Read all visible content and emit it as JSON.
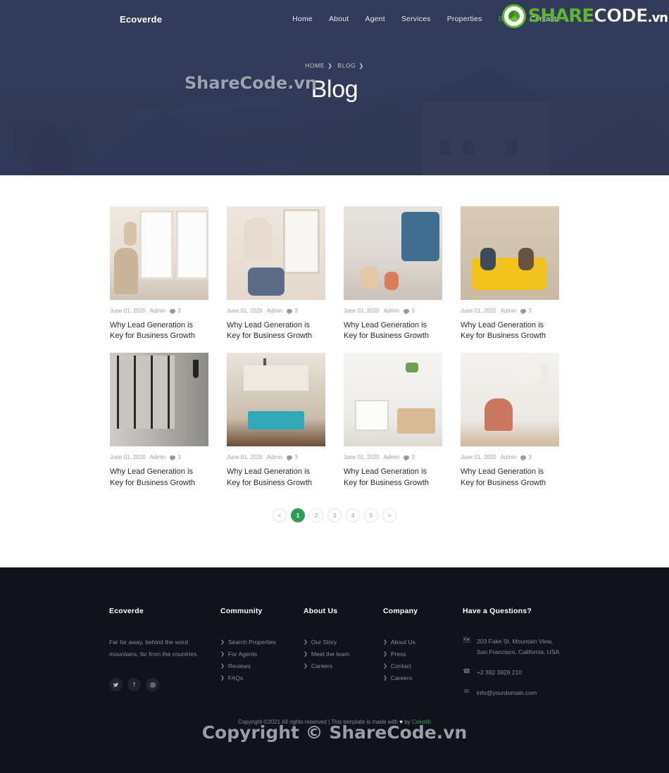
{
  "site": {
    "brand": "Ecoverde"
  },
  "nav": {
    "items": [
      {
        "label": "Home",
        "active": false
      },
      {
        "label": "About",
        "active": false
      },
      {
        "label": "Agent",
        "active": false
      },
      {
        "label": "Services",
        "active": false
      },
      {
        "label": "Properties",
        "active": false
      },
      {
        "label": "Blog",
        "active": true
      },
      {
        "label": "Contact",
        "active": false
      }
    ]
  },
  "watermark": {
    "hero": "ShareCode.vn",
    "footer": "Copyright © ShareCode.vn",
    "logo_share": "SHARE",
    "logo_code": "CODE",
    "logo_vn": ".vn"
  },
  "hero": {
    "breadcrumb": [
      {
        "label": "HOME"
      },
      {
        "label": "BLOG"
      }
    ],
    "separator": "❯",
    "title": "Blog"
  },
  "blog": {
    "posts": [
      {
        "date": "June 01, 2020",
        "author": "Admin",
        "comments": "3",
        "title": "Why Lead Generation is Key for Business Growth",
        "image": "mother-and-baby-by-window"
      },
      {
        "date": "June 01, 2020",
        "author": "Admin",
        "comments": "3",
        "title": "Why Lead Generation is Key for Business Growth",
        "image": "mother-holding-toddler"
      },
      {
        "date": "June 01, 2020",
        "author": "Admin",
        "comments": "3",
        "title": "Why Lead Generation is Key for Business Growth",
        "image": "family-playing-in-living-room"
      },
      {
        "date": "June 01, 2020",
        "author": "Admin",
        "comments": "3",
        "title": "Why Lead Generation is Key for Business Growth",
        "image": "family-on-yellow-sofa-with-boxes"
      },
      {
        "date": "June 01, 2020",
        "author": "Admin",
        "comments": "3",
        "title": "Why Lead Generation is Key for Business Growth",
        "image": "modern-glass-hallway"
      },
      {
        "date": "June 01, 2020",
        "author": "Admin",
        "comments": "3",
        "title": "Why Lead Generation is Key for Business Growth",
        "image": "kitchen-with-blue-island"
      },
      {
        "date": "June 01, 2020",
        "author": "Admin",
        "comments": "3",
        "title": "Why Lead Generation is Key for Business Growth",
        "image": "white-dining-room"
      },
      {
        "date": "June 01, 2020",
        "author": "Admin",
        "comments": "3",
        "title": "Why Lead Generation is Key for Business Growth",
        "image": "pink-chair-with-balloons"
      }
    ]
  },
  "pagination": {
    "prev": "<",
    "next": ">",
    "pages": [
      {
        "label": "1",
        "active": true
      },
      {
        "label": "2",
        "active": false
      },
      {
        "label": "3",
        "active": false
      },
      {
        "label": "4",
        "active": false
      },
      {
        "label": "5",
        "active": false
      }
    ]
  },
  "footer": {
    "brand": {
      "heading": "Ecoverde",
      "description": "Far far away, behind the word mountains, far from the countries.",
      "socials": [
        {
          "name": "twitter",
          "glyph": "🐦"
        },
        {
          "name": "facebook",
          "glyph": "f"
        },
        {
          "name": "instagram",
          "glyph": "▣"
        }
      ]
    },
    "columns": [
      {
        "heading": "Community",
        "links": [
          "Search Properties",
          "For Agents",
          "Reviews",
          "FAQs"
        ]
      },
      {
        "heading": "About Us",
        "links": [
          "Our Story",
          "Meet the team",
          "Careers"
        ]
      },
      {
        "heading": "Company",
        "links": [
          "About Us",
          "Press",
          "Contact",
          "Careers"
        ]
      }
    ],
    "contact": {
      "heading": "Have a Questions?",
      "address": "203 Fake St. Mountain View, San Francisco, California, USA",
      "phone": "+2 392 3929 210",
      "email": "info@yourdomain.com"
    },
    "copyright": {
      "before": "Copyright ©2021 All rights reserved | This template is made with",
      "heart": "♥",
      "middle": "by",
      "link": "Colorlib"
    }
  },
  "colors": {
    "accent_green": "#2e9e55",
    "hero_navy": "#333b58",
    "footer_dark": "#12121c",
    "logo_green": "#5fb431"
  }
}
